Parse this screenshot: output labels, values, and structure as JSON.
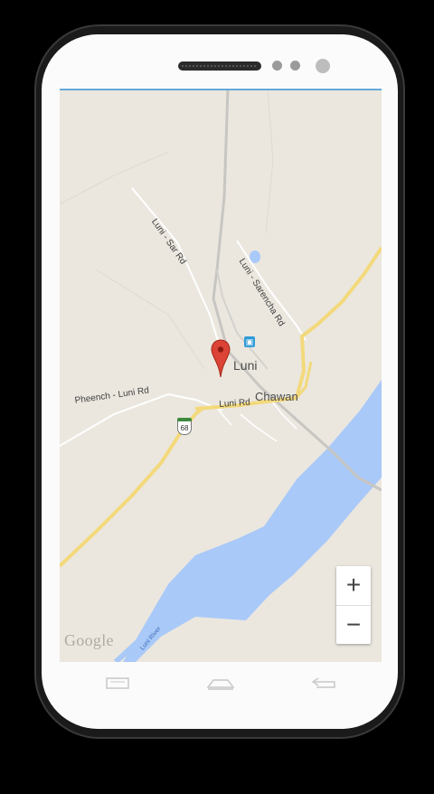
{
  "map": {
    "place_label": "Luni",
    "village_label": "Chawan",
    "road_labels": {
      "luni_sar": "Luni - Sar Rd",
      "luni_sarencha": "Luni - Sarencha Rd",
      "pheench_luni": "Pheench - Luni Rd",
      "luni_rd": "Luni Rd"
    },
    "highway_shield": "68",
    "river_label": "Luni River",
    "attribution": "Google",
    "colors": {
      "land": "#ebe7df",
      "water": "#a9c9f8",
      "major_road": "#f3d97b",
      "minor_road": "#ffffff",
      "rail": "#c8c6c2",
      "pin": "#db4437"
    }
  },
  "controls": {
    "zoom_in": "+",
    "zoom_out": "−"
  },
  "nav_bar": {
    "menu_icon": "menu-icon",
    "home_icon": "home-icon",
    "back_icon": "back-icon"
  }
}
